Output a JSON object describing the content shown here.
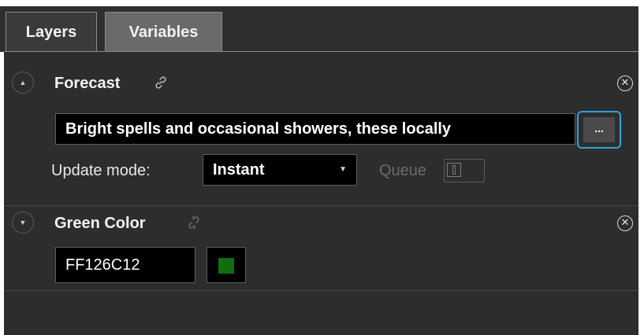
{
  "tabs": [
    {
      "label": "Layers",
      "active": false
    },
    {
      "label": "Variables",
      "active": true
    }
  ],
  "variables": [
    {
      "name": "Forecast",
      "collapse_icon": "chevron-up-icon",
      "link_icon": "link-icon",
      "value": "Bright spells and occasional showers, these locally",
      "edit_button_label": "...",
      "update_mode_label": "Update mode:",
      "update_mode_value": "Instant",
      "queue_label": "Queue",
      "queue_enabled": false
    },
    {
      "name": "Green Color",
      "collapse_icon": "chevron-down-icon",
      "link_icon": "broken-link-icon",
      "value": "FF126C12",
      "swatch_color": "#126C12"
    }
  ],
  "colors": {
    "background": "#2d2d2d",
    "accent_focus": "#2ea3dd",
    "input_bg": "#000000"
  }
}
